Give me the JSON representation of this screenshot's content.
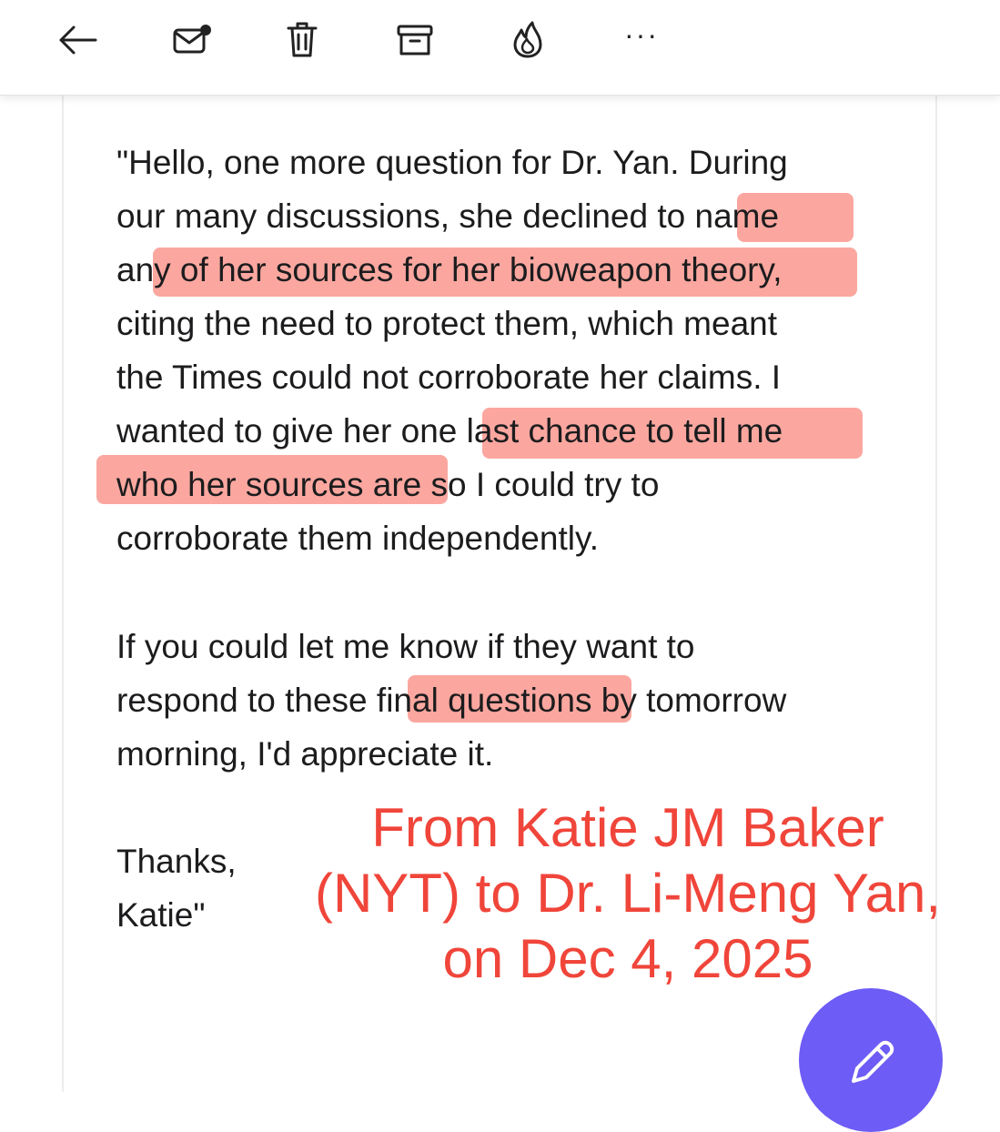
{
  "toolbar": {
    "buttons": [
      {
        "icon": "back-arrow-icon"
      },
      {
        "icon": "mark-unread-icon"
      },
      {
        "icon": "trash-icon"
      },
      {
        "icon": "archive-icon"
      },
      {
        "icon": "flame-icon"
      },
      {
        "icon": "more-icon",
        "label": "···"
      }
    ]
  },
  "message": {
    "paragraph1_lines": [
      "\"Hello, one more question for Dr. Yan. During",
      "our many discussions, she declined to name",
      "any of her sources for her bioweapon theory,",
      "citing the need to protect them, which meant",
      "the Times could not corroborate her claims. I",
      "wanted to give her one last chance to tell me",
      "who her sources are so I could try to",
      "corroborate them independently."
    ],
    "paragraph2_lines": [
      "If you could let me know if they want to",
      "respond to these final questions by tomorrow",
      "morning, I'd appreciate it."
    ],
    "signoff": "Thanks,",
    "signature": "Katie\""
  },
  "annotation": {
    "lines": [
      "From Katie JM Baker",
      "(NYT) to Dr. Li-Meng Yan,",
      "on Dec 4, 2025"
    ],
    "color": "#f0453a",
    "highlight_color": "#f9857a"
  },
  "compose": {
    "icon": "pencil-icon",
    "color": "#6d5cf5"
  },
  "colors": {
    "text": "#1c1c1e",
    "background": "#ffffff"
  }
}
